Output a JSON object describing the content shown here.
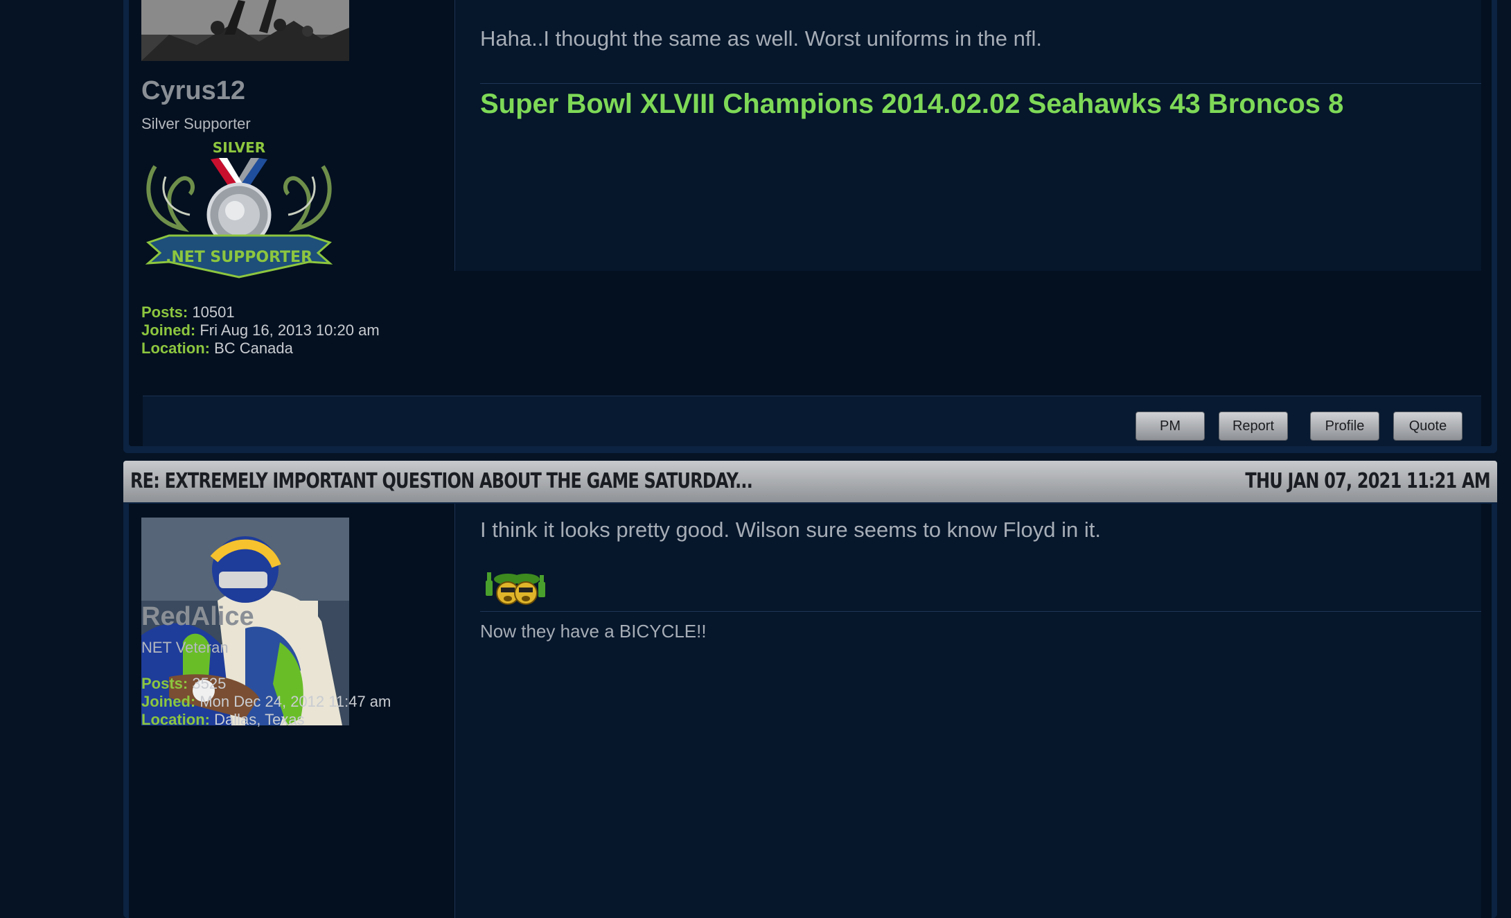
{
  "posts": [
    {
      "author": {
        "name": "Cyrus12",
        "rank": "Silver Supporter",
        "badge_text_top": "SILVER",
        "badge_text_ribbon": ".NET SUPPORTER",
        "stats": {
          "posts_label": "Posts:",
          "posts": "10501",
          "joined_label": "Joined:",
          "joined": "Fri Aug 16, 2013 10:20 am",
          "location_label": "Location:",
          "location": "BC Canada"
        }
      },
      "body": "Haha..I thought the same as well. Worst uniforms in the nfl.",
      "signature": "Super Bowl XLVIII Champions 2014.02.02 Seahawks 43 Broncos 8",
      "actions": {
        "pm": "PM",
        "report": "Report",
        "profile": "Profile",
        "quote": "Quote"
      }
    },
    {
      "header": {
        "title": "RE: EXTREMELY IMPORTANT QUESTION ABOUT THE GAME SATURDAY...",
        "date": "THU JAN 07, 2021 11:21 AM"
      },
      "author": {
        "name": "RedAlice",
        "rank": "NET Veteran",
        "stats": {
          "posts_label": "Posts:",
          "posts": "3525",
          "joined_label": "Joined:",
          "joined": "Mon Dec 24, 2012 11:47 am",
          "location_label": "Location:",
          "location": "Dallas, Texas"
        }
      },
      "body": "I think it looks pretty good. Wilson sure seems to know Floyd in it.",
      "emoji": "cheers-smiley-icon",
      "signature": "Now they have a BICYCLE!!"
    }
  ],
  "colors": {
    "label_green": "#8dc63f",
    "signature_green": "#7ed957",
    "page_bg": "#061325"
  }
}
